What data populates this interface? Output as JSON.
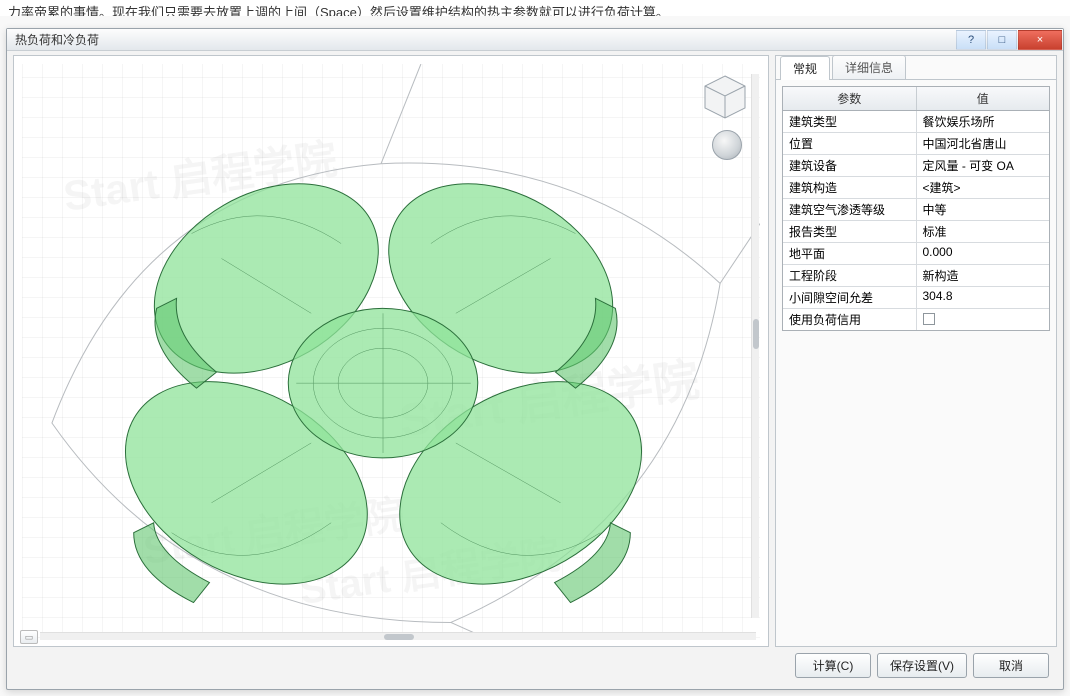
{
  "top_context": "力率帝累的事情。现在我们只需要去放置上调的上间（Space）然后设置维护结构的热主参数就可以进行负荷计算。",
  "dialog": {
    "title": "热负荷和冷负荷",
    "help_label": "?",
    "maximize_label": "□",
    "close_label": "×"
  },
  "tabs": [
    {
      "id": "tab-general",
      "label": "常规",
      "active": true
    },
    {
      "id": "tab-details",
      "label": "详细信息",
      "active": false
    }
  ],
  "param_header": {
    "col_param": "参数",
    "col_value": "值"
  },
  "params": [
    {
      "label": "建筑类型",
      "value": "餐饮娱乐场所"
    },
    {
      "label": "位置",
      "value": "中国河北省唐山"
    },
    {
      "label": "建筑设备",
      "value": "定风量 - 可变 OA"
    },
    {
      "label": "建筑构造",
      "value": "<建筑>"
    },
    {
      "label": "建筑空气渗透等级",
      "value": "中等"
    },
    {
      "label": "报告类型",
      "value": "标准"
    },
    {
      "label": "地平面",
      "value": "0.000"
    },
    {
      "label": "工程阶段",
      "value": "新构造"
    },
    {
      "label": "小间隙空间允差",
      "value": "304.8"
    },
    {
      "label": "使用负荷信用",
      "value": "__checkbox__"
    }
  ],
  "buttons": {
    "calculate": "计算(C)",
    "save_settings": "保存设置(V)",
    "cancel": "取消"
  },
  "watermark": "Start 启程学院"
}
